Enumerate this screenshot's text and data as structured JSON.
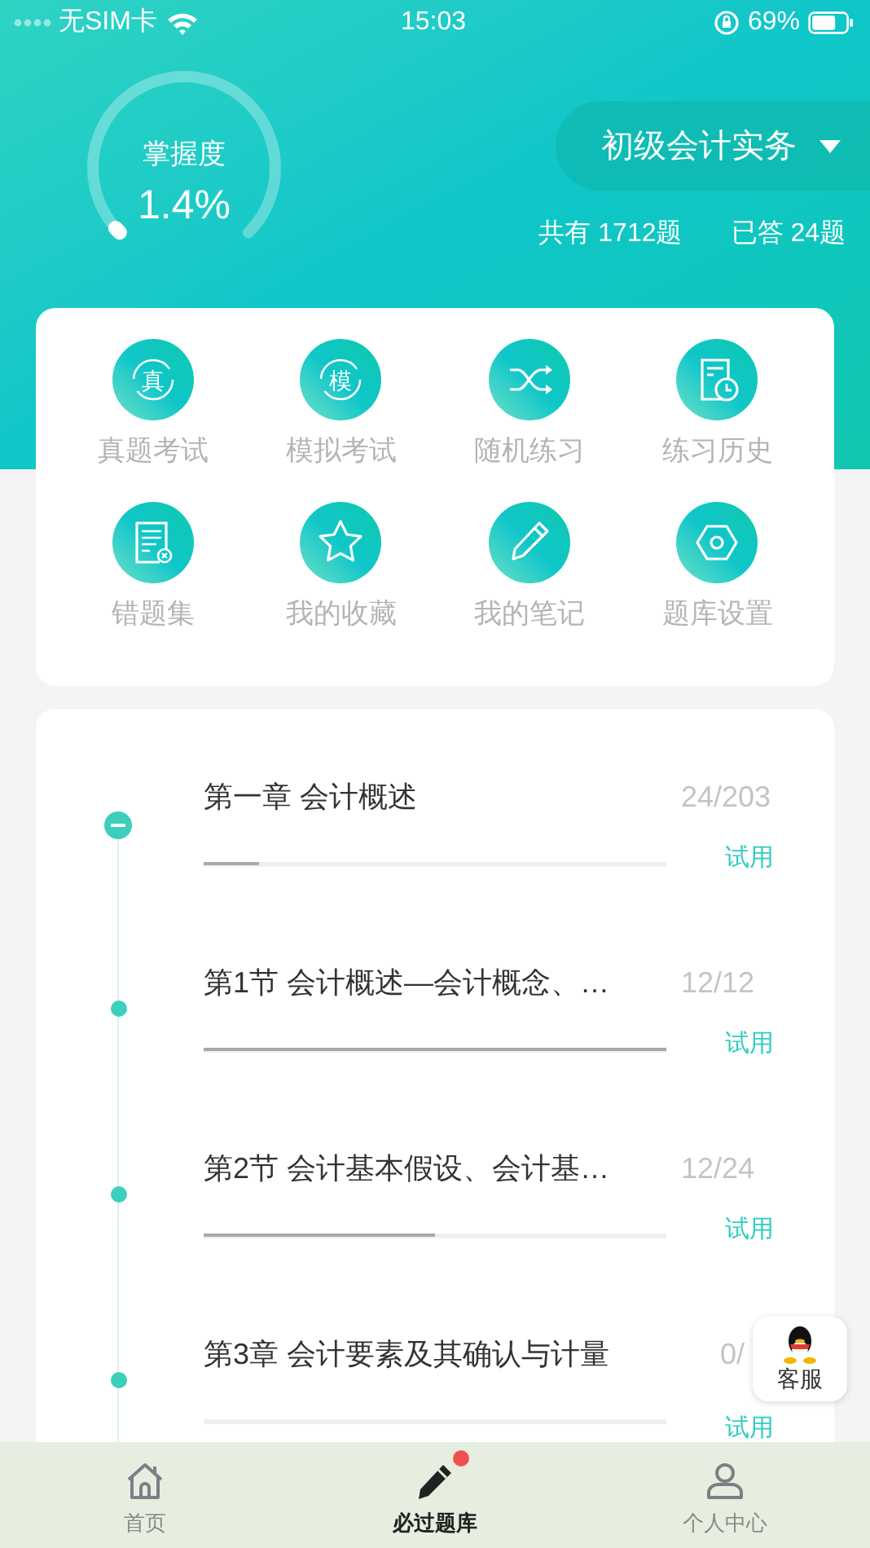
{
  "status_bar": {
    "carrier": "无SIM卡",
    "time": "15:03",
    "battery": "69%"
  },
  "mastery": {
    "label": "掌握度",
    "value": "1.4%",
    "level": 0.014
  },
  "subject": {
    "name": "初级会计实务"
  },
  "stats": [
    "共有 1712题",
    "已答 24题"
  ],
  "features": [
    {
      "label": "真题考试",
      "glyph": "真"
    },
    {
      "label": "模拟考试",
      "glyph": "模"
    },
    {
      "label": "随机练习"
    },
    {
      "label": "练习历史"
    },
    {
      "label": "错题集"
    },
    {
      "label": "我的收藏"
    },
    {
      "label": "我的笔记"
    },
    {
      "label": "题库设置"
    }
  ],
  "chapters": [
    {
      "title": "第一章 会计概述",
      "count": "24/203",
      "trial": "试用",
      "level": 0.12,
      "expanded": true
    },
    {
      "title": "第1节 会计概述—会计概念、…",
      "count": "12/12",
      "trial": "试用",
      "level": 1
    },
    {
      "title": "第2节 会计基本假设、会计基…",
      "count": "12/24",
      "trial": "试用",
      "level": 0.5
    },
    {
      "title": "第3章 会计要素及其确认与计量",
      "count": "0/",
      "trial": "试用",
      "level": 0
    }
  ],
  "support_button": {
    "label": "客服"
  },
  "tabs": [
    {
      "label": "首页",
      "selected": false,
      "badge": false
    },
    {
      "label": "必过题库",
      "selected": true,
      "badge": true
    },
    {
      "label": "个人中心",
      "selected": false,
      "badge": false
    }
  ]
}
